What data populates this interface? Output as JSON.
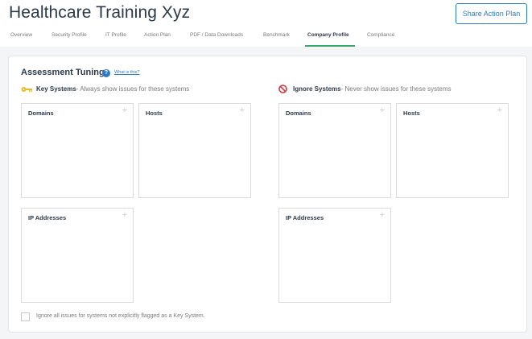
{
  "header": {
    "title": "Healthcare Training Xyz",
    "share_button": "Share Action Plan"
  },
  "tabs": [
    {
      "label": "Overview"
    },
    {
      "label": "Security Profile"
    },
    {
      "label": "IT Profile"
    },
    {
      "label": "Action Plan"
    },
    {
      "label": "PDF / Data Downloads"
    },
    {
      "label": "Benchmark"
    },
    {
      "label": "Company Profile",
      "active": true
    },
    {
      "label": "Compliance"
    }
  ],
  "assessment": {
    "heading": "Assessment Tuning",
    "help_link": "What is this?",
    "key_systems": {
      "title": "Key Systems",
      "description": "- Always show issues for these systems",
      "icon": "key-icon",
      "domains_label": "Domains",
      "hosts_label": "Hosts",
      "ip_label": "IP Addresses"
    },
    "ignore_systems": {
      "title": "Ignore Systems",
      "description": "- Never show issues for these systems",
      "icon": "ban-icon",
      "domains_label": "Domains",
      "hosts_label": "Hosts",
      "ip_label": "IP Addresses"
    },
    "checkbox_label": "Ignore all issues for systems not explicitly flagged as a Key System.",
    "plus_symbol": "+"
  },
  "colors": {
    "accent": "#2d7bc4",
    "active_tab_underline": "#3ea66b",
    "key_icon": "#e8b923",
    "ban_icon": "#d9363e"
  }
}
